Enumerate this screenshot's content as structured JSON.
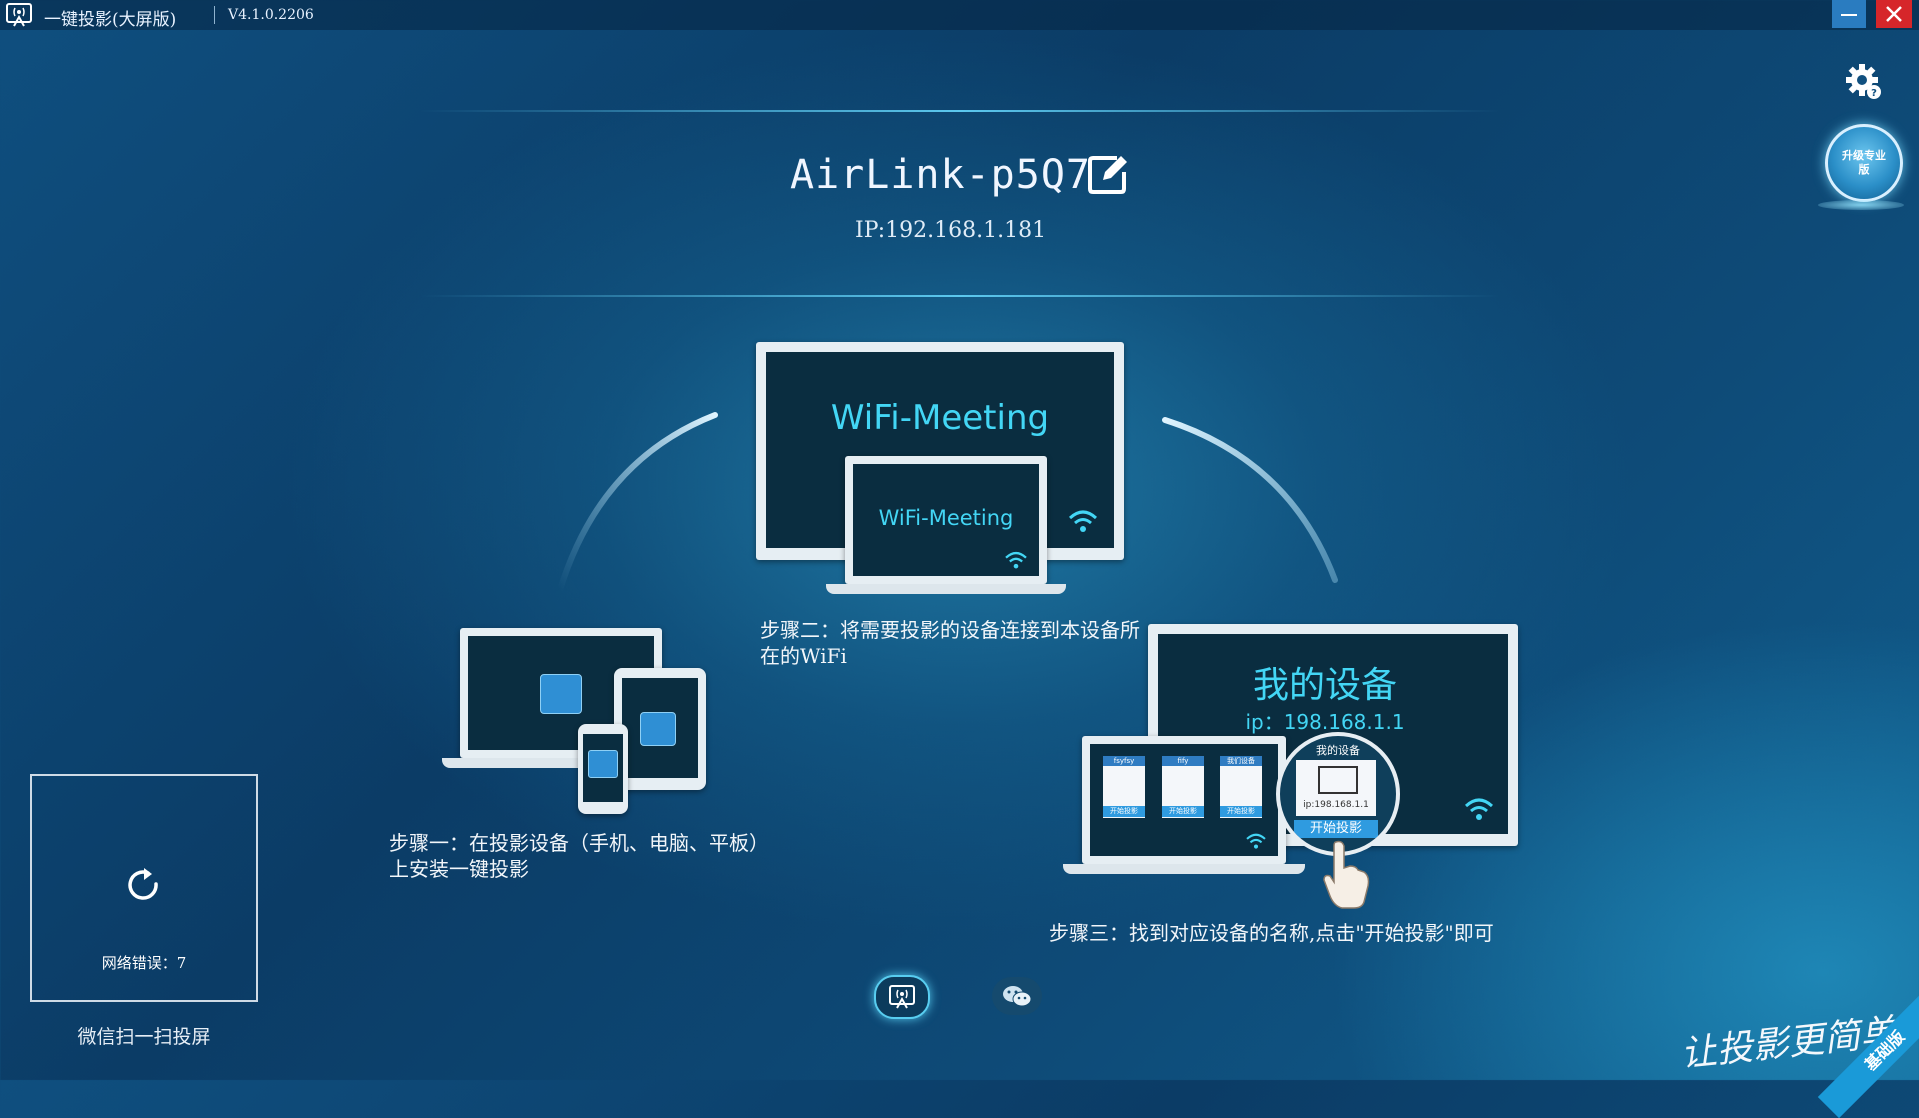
{
  "window": {
    "title": "一键投影(大屏版)",
    "version": "V4.1.0.2206"
  },
  "upgrade_button": {
    "label": "升级专业版"
  },
  "header": {
    "device_name": "AirLink-p5Q7",
    "ip": "IP:192.168.1.181"
  },
  "illustrations": {
    "wifi_tv_label": "WiFi-Meeting",
    "wifi_laptop_label": "WiFi-Meeting",
    "my_device_title": "我的设备",
    "my_device_ip": "ip：198.168.1.1",
    "mini_cards": [
      "fsyfsy",
      "fify",
      "我们设备"
    ],
    "mini_card_button": "开始投影",
    "zoom_card_title": "我的设备",
    "zoom_card_ip": "ip:198.168.1.1",
    "zoom_card_button": "开始投影"
  },
  "steps": {
    "step1": "步骤一：在投影设备（手机、电脑、平板）上安装一键投影",
    "step2": "步骤二：将需要投影的设备连接到本设备所在的WiFi",
    "step3": "步骤三：找到对应设备的名称,点击\"开始投影\"即可"
  },
  "qr_panel": {
    "error_text": "网络错误：7",
    "label": "微信扫一扫投屏"
  },
  "branding": {
    "slogan": "让投影更简单",
    "edition_ribbon": "基础版"
  },
  "colors": {
    "accent": "#43d6f5",
    "close_button": "#d6262a",
    "minimize_button": "#2a7cc0"
  }
}
